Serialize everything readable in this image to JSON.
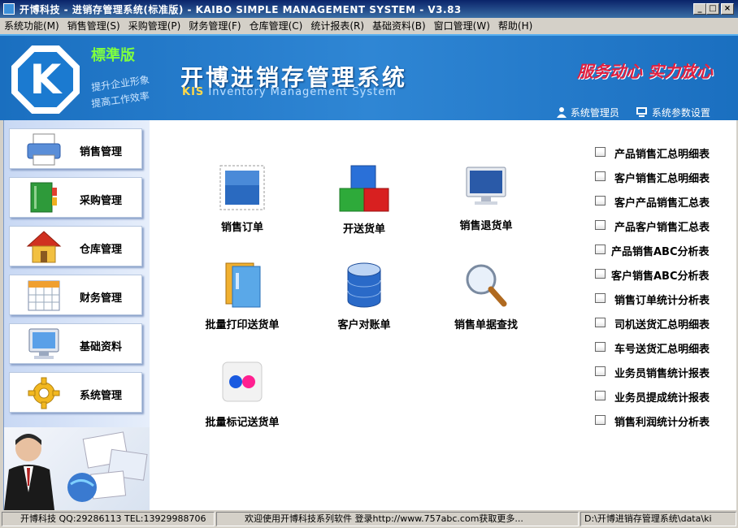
{
  "window": {
    "title": "开博科技 - 进销存管理系统(标准版) - KAIBO SIMPLE MANAGEMENT SYSTEM - V3.83",
    "controls": [
      "_",
      "□",
      "×"
    ]
  },
  "menu": [
    "系统功能(M)",
    "销售管理(S)",
    "采购管理(P)",
    "财务管理(F)",
    "仓库管理(C)",
    "统计报表(R)",
    "基础资料(B)",
    "窗口管理(W)",
    "帮助(H)"
  ],
  "banner": {
    "logo_letter": "K",
    "edition": "標準版",
    "slogan_line1": "提升企业形象",
    "slogan_line2": "提高工作效率",
    "system_name": "开博进销存管理系统",
    "system_name_en_prefix": "KIS",
    "system_name_en": "Inventory Management System",
    "motto": "服务动心 实力放心",
    "admin_link": "系统管理员",
    "params_link": "系统参数设置"
  },
  "sidebar": {
    "items": [
      {
        "label": "销售管理",
        "icon": "printer-icon"
      },
      {
        "label": "采购管理",
        "icon": "book-icon"
      },
      {
        "label": "仓库管理",
        "icon": "house-icon"
      },
      {
        "label": "财务管理",
        "icon": "calendar-icon"
      },
      {
        "label": "基础资料",
        "icon": "monitor-icon"
      },
      {
        "label": "系统管理",
        "icon": "gear-icon"
      }
    ]
  },
  "tiles": [
    {
      "label": "销售订单",
      "icon": "sales-order-icon"
    },
    {
      "label": "开送货单",
      "icon": "blocks-icon"
    },
    {
      "label": "销售退货单",
      "icon": "monitor-icon"
    },
    {
      "label": "批量打印送货单",
      "icon": "folder-icon"
    },
    {
      "label": "客户对账单",
      "icon": "database-icon"
    },
    {
      "label": "销售单据查找",
      "icon": "magnifier-icon"
    },
    {
      "label": "批量标记送货单",
      "icon": "flickr-icon"
    }
  ],
  "reports": [
    "产品销售汇总明细表",
    "客户销售汇总明细表",
    "客户产品销售汇总表",
    "产品客户销售汇总表",
    "产品销售ABC分析表",
    "客户销售ABC分析表",
    "销售订单统计分析表",
    "司机送货汇总明细表",
    "车号送货汇总明细表",
    "业务员销售统计报表",
    "业务员提成统计报表",
    "销售利润统计分析表"
  ],
  "statusbar": {
    "company": "开博科技 QQ:29286113 TEL:13929988706",
    "welcome": "欢迎使用开博科技系列软件  登录http://www.757abc.com获取更多...",
    "path": "D:\\开博进销存管理系统\\data\\ki"
  }
}
